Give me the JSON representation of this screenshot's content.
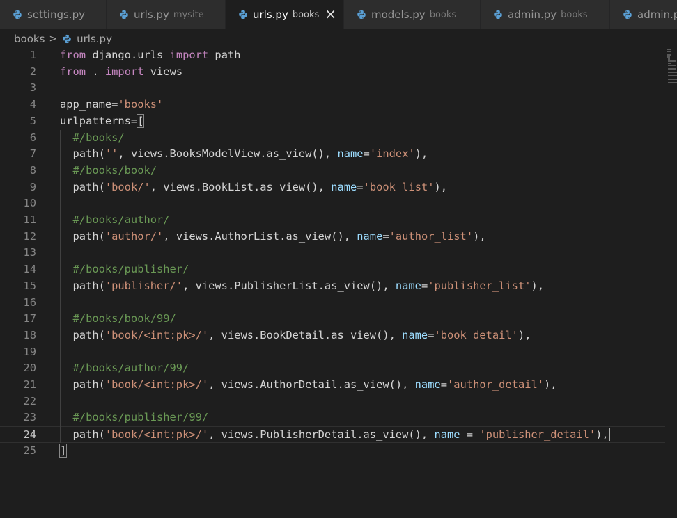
{
  "tabs": [
    {
      "name": "settings.py",
      "desc": "",
      "active": false
    },
    {
      "name": "urls.py",
      "desc": "mysite",
      "active": false
    },
    {
      "name": "urls.py",
      "desc": "books",
      "active": true,
      "close": "×"
    },
    {
      "name": "models.py",
      "desc": "books",
      "active": false
    },
    {
      "name": "admin.py",
      "desc": "books",
      "active": false
    },
    {
      "name": "admin.p",
      "desc": "",
      "active": false
    }
  ],
  "breadcrumb": {
    "folder": "books",
    "separator": ">",
    "file": "urls.py"
  },
  "editor": {
    "current_line": 24,
    "lines": [
      {
        "n": "1",
        "text": "from django.urls import path"
      },
      {
        "n": "2",
        "text": "from . import views"
      },
      {
        "n": "3",
        "text": ""
      },
      {
        "n": "4",
        "text": "app_name='books'"
      },
      {
        "n": "5",
        "text": "urlpatterns=["
      },
      {
        "n": "6",
        "text": "  #/books/"
      },
      {
        "n": "7",
        "text": "  path('', views.BooksModelView.as_view(), name='index'),"
      },
      {
        "n": "8",
        "text": "  #/books/book/"
      },
      {
        "n": "9",
        "text": "  path('book/', views.BookList.as_view(), name='book_list'),"
      },
      {
        "n": "10",
        "text": ""
      },
      {
        "n": "11",
        "text": "  #/books/author/"
      },
      {
        "n": "12",
        "text": "  path('author/', views.AuthorList.as_view(), name='author_list'),"
      },
      {
        "n": "13",
        "text": ""
      },
      {
        "n": "14",
        "text": "  #/books/publisher/"
      },
      {
        "n": "15",
        "text": "  path('publisher/', views.PublisherList.as_view(), name='publisher_list'),"
      },
      {
        "n": "16",
        "text": ""
      },
      {
        "n": "17",
        "text": "  #/books/book/99/"
      },
      {
        "n": "18",
        "text": "  path('book/<int:pk>/', views.BookDetail.as_view(), name='book_detail'),"
      },
      {
        "n": "19",
        "text": ""
      },
      {
        "n": "20",
        "text": "  #/books/author/99/"
      },
      {
        "n": "21",
        "text": "  path('book/<int:pk>/', views.AuthorDetail.as_view(), name='author_detail'),"
      },
      {
        "n": "22",
        "text": ""
      },
      {
        "n": "23",
        "text": "  #/books/publisher/99/"
      },
      {
        "n": "24",
        "text": "  path('book/<int:pk>/', views.PublisherDetail.as_view(), name = 'publisher_detail'),"
      },
      {
        "n": "25",
        "text": "]"
      }
    ]
  },
  "colors": {
    "keyword": "#c586c0",
    "string": "#ce9178",
    "comment": "#6a9955",
    "parameter": "#9cdcfe",
    "default_text": "#d4d4d4",
    "background": "#1e1e1e"
  },
  "icons": {
    "tab_file": "python-icon",
    "breadcrumb_file": "python-icon",
    "tab_close": "close-icon"
  }
}
